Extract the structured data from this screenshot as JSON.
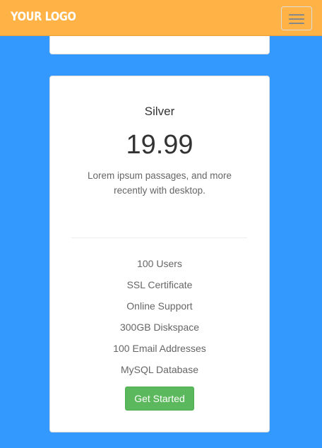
{
  "navbar": {
    "logo": "YOUR LOGO",
    "menu_icon": "hamburger-menu-icon"
  },
  "colors": {
    "page_background": "#3399ff",
    "navbar_background": "#ffb347",
    "button_success": "#5cb85c"
  },
  "plan": {
    "name": "Silver",
    "price": "19.99",
    "description": "Lorem ipsum passages, and more recently with desktop.",
    "features": [
      "100 Users",
      "SSL Certificate",
      "Online Support",
      "300GB Diskspace",
      "100 Email Addresses",
      "MySQL Database"
    ],
    "cta_label": "Get Started"
  }
}
